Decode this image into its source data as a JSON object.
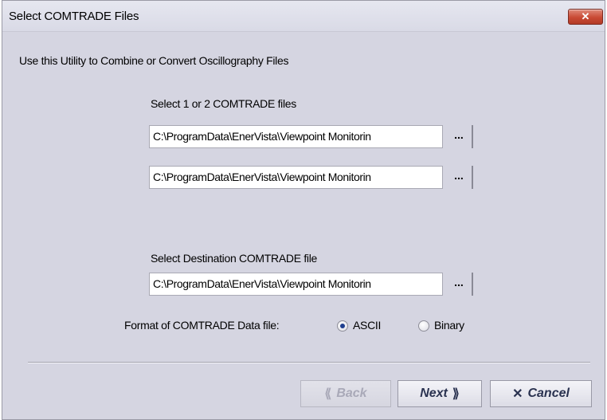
{
  "window": {
    "title": "Select COMTRADE Files",
    "close_label": "✕"
  },
  "intro": "Use this Utility to Combine or Convert Oscillography Files",
  "source": {
    "label": "Select 1 or 2  COMTRADE files",
    "file1": "C:\\ProgramData\\EnerVista\\Viewpoint Monitorin",
    "file2": "C:\\ProgramData\\EnerVista\\Viewpoint Monitorin",
    "browse_label": "..."
  },
  "destination": {
    "label": "Select Destination COMTRADE file",
    "file": "C:\\ProgramData\\EnerVista\\Viewpoint Monitorin",
    "browse_label": "..."
  },
  "format": {
    "label": "Format of COMTRADE Data file:",
    "options": [
      {
        "label": "ASCII",
        "selected": true
      },
      {
        "label": "Binary",
        "selected": false
      }
    ]
  },
  "buttons": {
    "back": {
      "label": "Back",
      "icon": "⟪",
      "enabled": false
    },
    "next": {
      "label": "Next",
      "icon": "⟫",
      "enabled": true
    },
    "cancel": {
      "label": "Cancel",
      "icon": "✕",
      "enabled": true
    }
  }
}
